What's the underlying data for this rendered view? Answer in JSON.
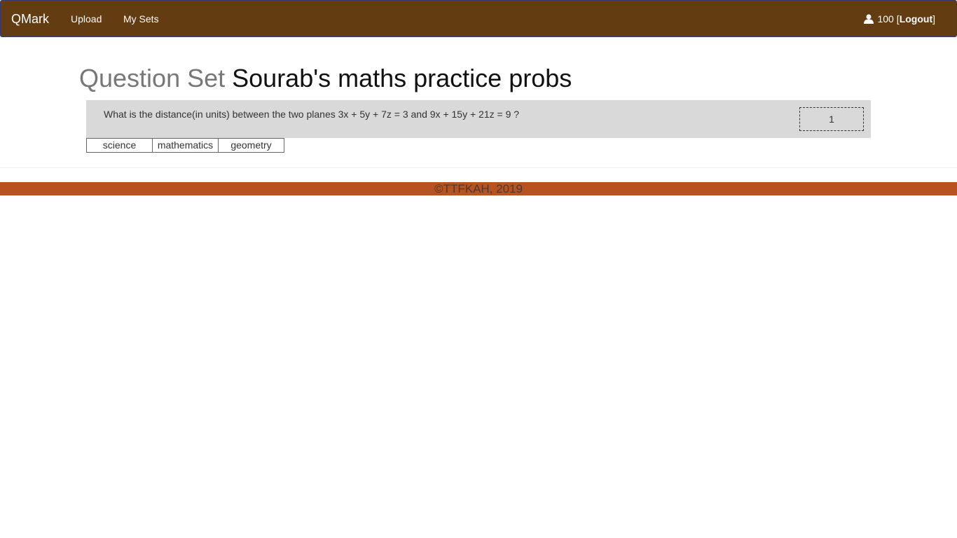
{
  "navbar": {
    "brand": "QMark",
    "links": [
      "Upload",
      "My Sets"
    ],
    "user_score": "100",
    "bracket_open": "[",
    "logout_label": "Logout",
    "bracket_close": "]",
    "user_icon": "user-icon"
  },
  "page": {
    "title_prefix": "Question Set",
    "set_name": "Sourab's maths practice probs"
  },
  "questions": [
    {
      "text": "What is the distance(in units) between the two planes 3x + 5y + 7z = 3 and 9x + 15y + 21z = 9 ?",
      "answer": "1"
    }
  ],
  "tags": [
    "science",
    "mathematics",
    "geometry"
  ],
  "footer": {
    "text": "©TTFKAH, 2019"
  },
  "colors": {
    "navbar_bg": "#643c12",
    "question_bg": "#d9d9d9",
    "footer_bg": "#b8531f"
  }
}
